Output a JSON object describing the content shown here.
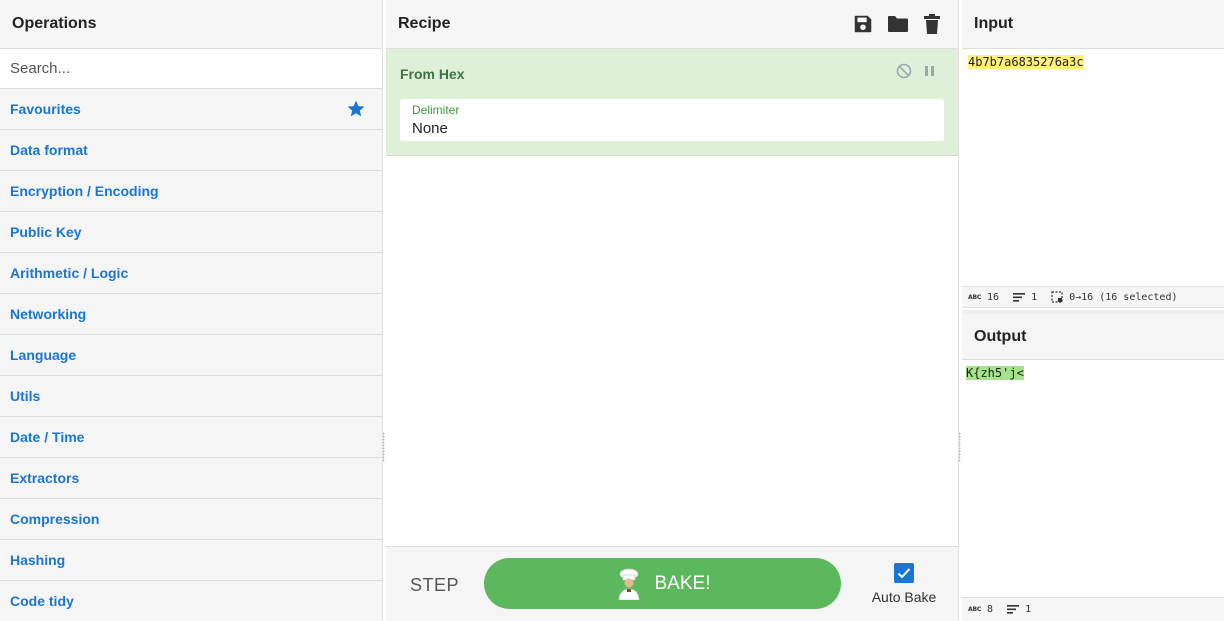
{
  "operations": {
    "title": "Operations",
    "search_placeholder": "Search...",
    "categories": [
      "Favourites",
      "Data format",
      "Encryption / Encoding",
      "Public Key",
      "Arithmetic / Logic",
      "Networking",
      "Language",
      "Utils",
      "Date / Time",
      "Extractors",
      "Compression",
      "Hashing",
      "Code tidy"
    ]
  },
  "recipe": {
    "title": "Recipe",
    "operation": {
      "name": "From Hex",
      "arg_label": "Delimiter",
      "arg_value": "None"
    },
    "footer": {
      "step_label": "STEP",
      "bake_label": "BAKE!",
      "autobake_label": "Auto Bake",
      "autobake_checked": true
    }
  },
  "input": {
    "title": "Input",
    "value": "4b7b7a6835276a3c",
    "status": {
      "length": "16",
      "lines": "1",
      "selection": "0→16 (16 selected)"
    }
  },
  "output": {
    "title": "Output",
    "value": "K{zh5'j<",
    "status": {
      "length": "8",
      "lines": "1"
    }
  },
  "colors": {
    "accent_blue": "#1976d2",
    "bake_green": "#5cb85c",
    "op_card_bg": "#dff0d8",
    "input_highlight": "#fff176",
    "output_highlight": "#a5e28c"
  },
  "icons": [
    "star-icon",
    "save-icon",
    "folder-icon",
    "trash-icon",
    "disable-icon",
    "pause-icon",
    "chef-icon",
    "checkbox-icon",
    "abc-icon",
    "lines-icon",
    "selection-icon"
  ]
}
